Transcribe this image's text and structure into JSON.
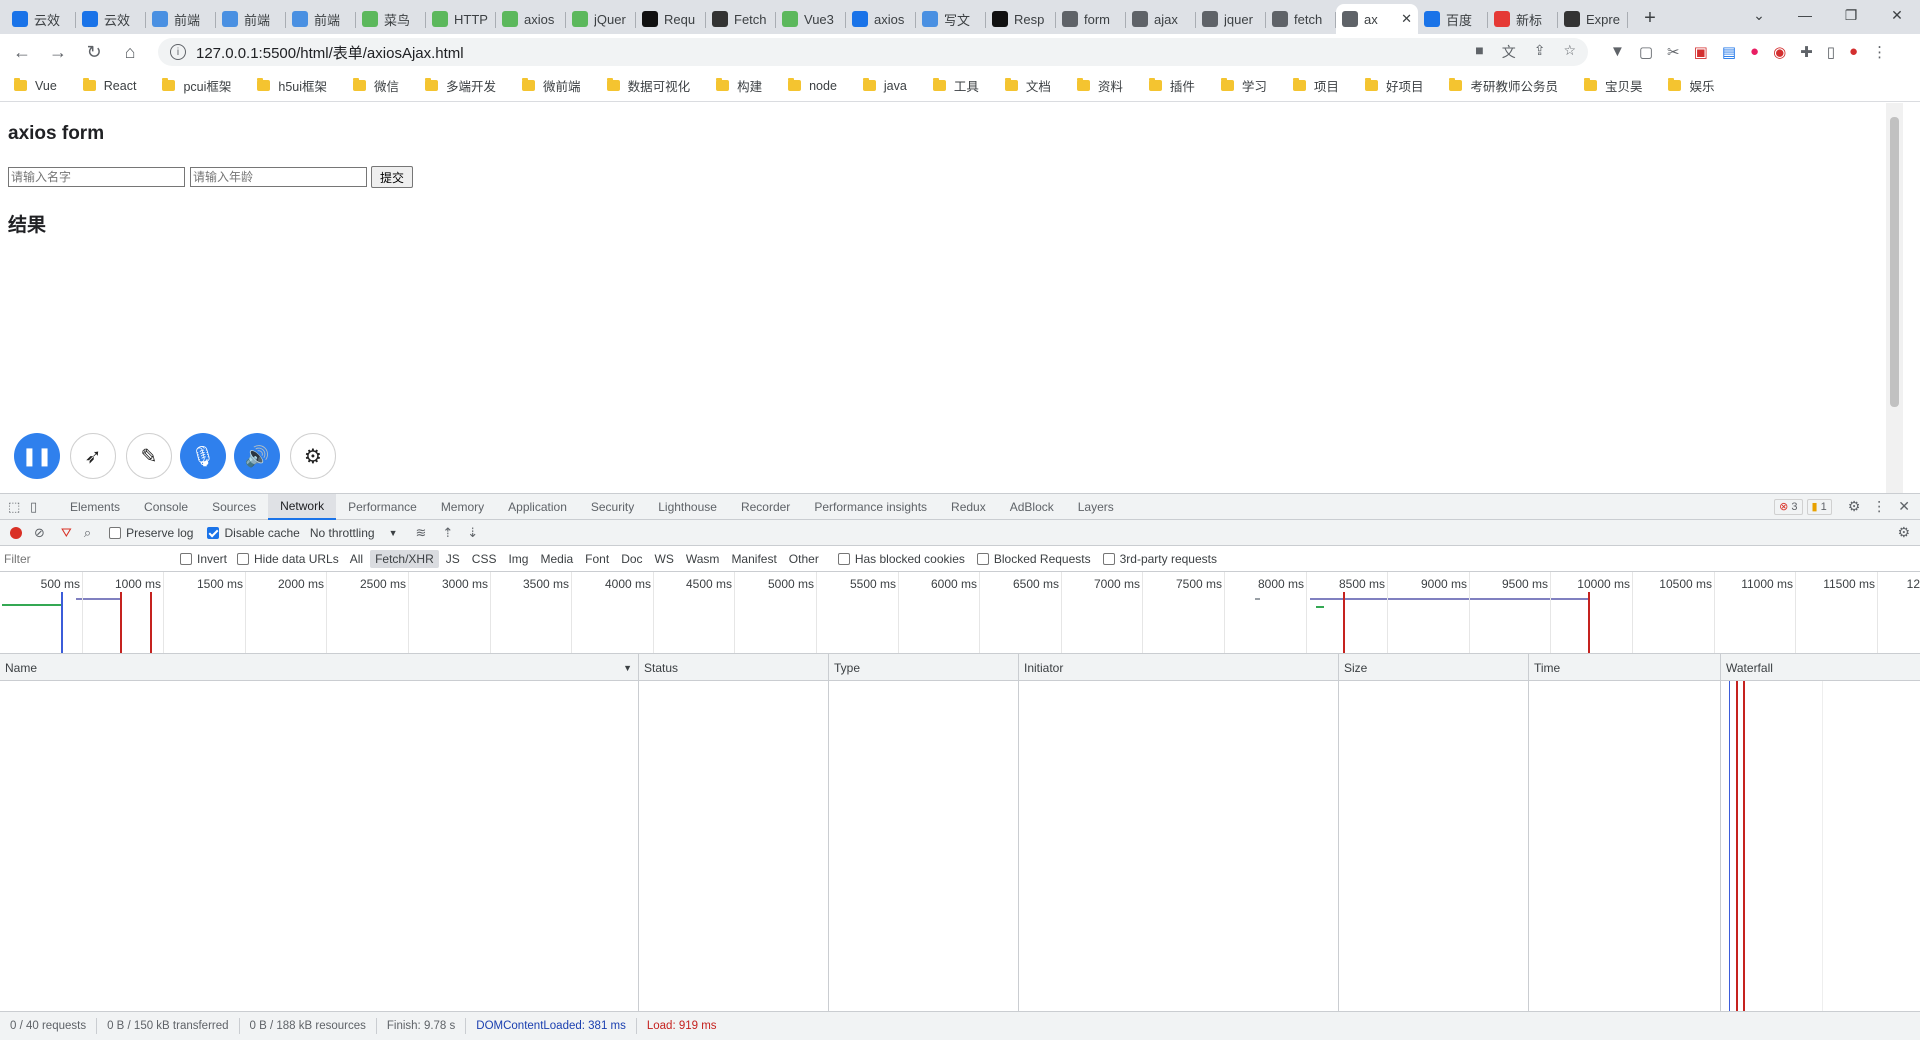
{
  "browser": {
    "tabs": [
      {
        "label": "云效",
        "color": "#1a73e8"
      },
      {
        "label": "云效",
        "color": "#1a73e8"
      },
      {
        "label": "前端",
        "color": "#4a90e2"
      },
      {
        "label": "前端",
        "color": "#4a90e2"
      },
      {
        "label": "前端",
        "color": "#4a90e2"
      },
      {
        "label": "菜鸟",
        "color": "#5cb85c"
      },
      {
        "label": "HTTP",
        "color": "#5cb85c"
      },
      {
        "label": "axios",
        "color": "#5cb85c"
      },
      {
        "label": "jQuer",
        "color": "#5cb85c"
      },
      {
        "label": "Requ",
        "color": "#111111"
      },
      {
        "label": "Fetch",
        "color": "#333333"
      },
      {
        "label": "Vue3",
        "color": "#5cb85c"
      },
      {
        "label": "axios",
        "color": "#1a73e8"
      },
      {
        "label": "写文",
        "color": "#4a90e2"
      },
      {
        "label": "Resp",
        "color": "#111111"
      },
      {
        "label": "form",
        "color": "#5f6368"
      },
      {
        "label": "ajax",
        "color": "#5f6368"
      },
      {
        "label": "jquer",
        "color": "#5f6368"
      },
      {
        "label": "fetch",
        "color": "#5f6368"
      },
      {
        "label": "ax",
        "color": "#5f6368",
        "active": true
      },
      {
        "label": "百度",
        "color": "#1a73e8"
      },
      {
        "label": "新标",
        "color": "#e53935"
      },
      {
        "label": "Expre",
        "color": "#333333"
      }
    ],
    "url": "127.0.0.1:5500/html/表单/axiosAjax.html",
    "bookmarks": [
      "Vue",
      "React",
      "pcui框架",
      "h5ui框架",
      "微信",
      "多端开发",
      "微前端",
      "数据可视化",
      "构建",
      "node",
      "java",
      "工具",
      "文档",
      "资料",
      "插件",
      "学习",
      "项目",
      "好项目",
      "考研教师公务员",
      "宝贝昊",
      "娱乐"
    ]
  },
  "page": {
    "title": "axios form",
    "name_placeholder": "请输入名字",
    "age_placeholder": "请输入年龄",
    "submit_label": "提交",
    "result_heading": "结果"
  },
  "devtools": {
    "tabs": [
      "Elements",
      "Console",
      "Sources",
      "Network",
      "Performance",
      "Memory",
      "Application",
      "Security",
      "Lighthouse",
      "Recorder",
      "Performance insights",
      "Redux",
      "AdBlock",
      "Layers"
    ],
    "active_tab": "Network",
    "error_count": "3",
    "warning_count": "1",
    "toolbar": {
      "preserve_log": "Preserve log",
      "disable_cache": "Disable cache",
      "throttling": "No throttling"
    },
    "filter": {
      "placeholder": "Filter",
      "invert": "Invert",
      "hide_data_urls": "Hide data URLs",
      "types": [
        "All",
        "Fetch/XHR",
        "JS",
        "CSS",
        "Img",
        "Media",
        "Font",
        "Doc",
        "WS",
        "Wasm",
        "Manifest",
        "Other"
      ],
      "selected_type": "Fetch/XHR",
      "has_blocked_cookies": "Has blocked cookies",
      "blocked_requests": "Blocked Requests",
      "third_party": "3rd-party requests"
    },
    "timeline_ticks": [
      "500 ms",
      "1000 ms",
      "1500 ms",
      "2000 ms",
      "2500 ms",
      "3000 ms",
      "3500 ms",
      "4000 ms",
      "4500 ms",
      "5000 ms",
      "5500 ms",
      "6000 ms",
      "6500 ms",
      "7000 ms",
      "7500 ms",
      "8000 ms",
      "8500 ms",
      "9000 ms",
      "9500 ms",
      "10000 ms",
      "10500 ms",
      "11000 ms",
      "11500 ms",
      "12"
    ],
    "columns": [
      "Name",
      "Status",
      "Type",
      "Initiator",
      "Size",
      "Time",
      "Waterfall"
    ],
    "status": {
      "requests": "0 / 40 requests",
      "transferred": "0 B / 150 kB transferred",
      "resources": "0 B / 188 kB resources",
      "finish": "Finish: 9.78 s",
      "dom_loaded": "DOMContentLoaded: 381 ms",
      "load": "Load: 919 ms"
    }
  }
}
